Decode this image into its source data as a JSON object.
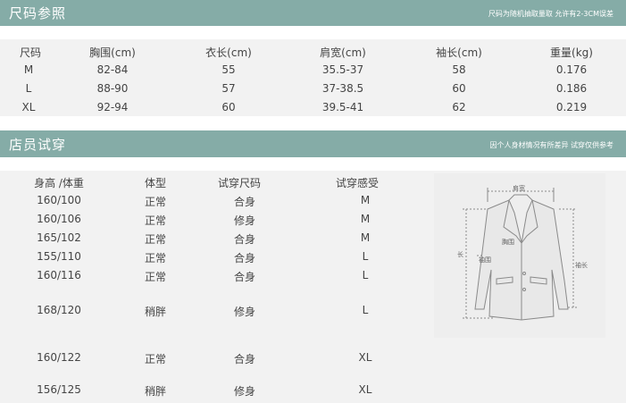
{
  "size_section": {
    "title": "尺码参照",
    "note": "尺码为随机抽取量取  允许有2-3CM误差",
    "headers": [
      "尺码",
      "胸围(cm)",
      "衣长(cm)",
      "肩宽(cm)",
      "袖长(cm)",
      "重量(kg)"
    ],
    "rows": [
      [
        "M",
        "82-84",
        "55",
        "35.5-37",
        "58",
        "0.176"
      ],
      [
        "L",
        "88-90",
        "57",
        "37-38.5",
        "60",
        "0.186"
      ],
      [
        "XL",
        "92-94",
        "60",
        "39.5-41",
        "62",
        "0.219"
      ]
    ]
  },
  "try_section": {
    "title": "店员试穿",
    "note": "因个人身材情况有所差异  试穿仅供参考",
    "headers": [
      "身高 /体重",
      "体型",
      "试穿尺码",
      "试穿感受"
    ],
    "rows": [
      [
        "160/100",
        "正常",
        "合身",
        "M"
      ],
      [
        "160/106",
        "正常",
        "修身",
        "M"
      ],
      [
        "165/102",
        "正常",
        "合身",
        "M"
      ],
      [
        "155/110",
        "正常",
        "合身",
        "L"
      ],
      [
        "160/116",
        "正常",
        "合身",
        "L"
      ],
      [
        "168/120",
        "稍胖",
        "修身",
        "L"
      ],
      [
        "160/122",
        "正常",
        "合身",
        "XL"
      ],
      [
        "156/125",
        "稍胖",
        "修身",
        "XL"
      ]
    ]
  },
  "diagram": {
    "shoulder_label": "肩宽",
    "chest_label": "胸围",
    "length_label": "长",
    "sleeve_hole_label": "袖围",
    "sleeve_length_label": "袖长"
  },
  "colors": {
    "banner": "#85aca7",
    "panel": "#f2f2f2",
    "text": "#444444"
  }
}
